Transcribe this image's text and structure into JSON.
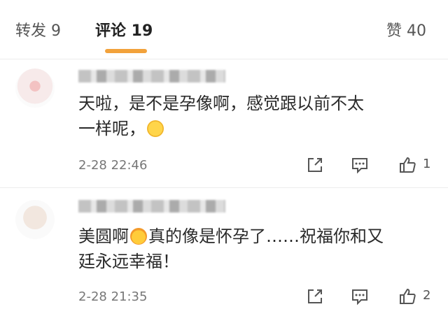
{
  "tabs": {
    "forward_label": "转发 9",
    "comments_label": "评论 19",
    "likes_label": "赞 40"
  },
  "comments": [
    {
      "text_line1": "天啦，是不是孕像啊，感觉跟以前不太",
      "text_line2": "一样呢，",
      "emoji": "crying-laughing-emoji",
      "time": "2-28 22:46",
      "like_count": "1"
    },
    {
      "text_part1": "美圆啊",
      "emoji": "blushing-emoji",
      "text_part2": "真的像是怀孕了……祝福你和又",
      "text_line2": "廷永远幸福！",
      "time": "2-28 21:35",
      "like_count": "2"
    }
  ],
  "icons": [
    "share-icon",
    "comment-icon",
    "thumbs-up-icon"
  ],
  "colors": {
    "accent": "#f2a23b",
    "text": "#2a2a2a",
    "muted": "#777777"
  }
}
